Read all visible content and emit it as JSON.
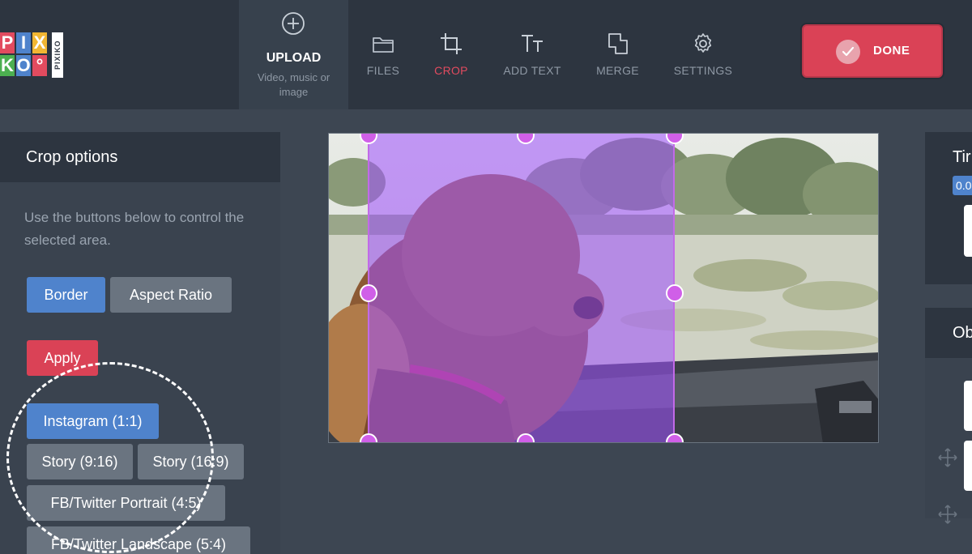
{
  "logo": {
    "row1": [
      "P",
      "I",
      "X",
      "I"
    ],
    "row2": [
      "K",
      "O",
      "°"
    ],
    "vertical_text": "PIXIKO",
    "tile_colors": [
      "#e24b5f",
      "#4f83cc",
      "#f2b632",
      "#4caf50"
    ]
  },
  "toolbar": {
    "upload": {
      "title": "UPLOAD",
      "subtitle": "Video, music or image",
      "icon": "plus-circle-icon"
    },
    "tools": [
      {
        "label": "FILES",
        "icon": "folder-icon",
        "active": false
      },
      {
        "label": "CROP",
        "icon": "crop-icon",
        "active": true
      },
      {
        "label": "ADD TEXT",
        "icon": "text-icon",
        "active": false
      },
      {
        "label": "MERGE",
        "icon": "merge-icon",
        "active": false
      },
      {
        "label": "SETTINGS",
        "icon": "gear-icon",
        "active": false
      }
    ],
    "done_label": "DONE"
  },
  "crop_panel": {
    "title": "Crop options",
    "description": "Use the buttons below to control the selected area.",
    "mode_buttons": [
      {
        "label": "Border",
        "selected": true
      },
      {
        "label": "Aspect Ratio",
        "selected": false
      }
    ],
    "apply_label": "Apply",
    "presets": [
      {
        "label": "Instagram (1:1)",
        "selected": true
      },
      {
        "label": "Story (9:16)",
        "selected": false
      },
      {
        "label": "Story (16:9)",
        "selected": false
      },
      {
        "label": "FB/Twitter Portrait (4:5)",
        "selected": false
      },
      {
        "label": "FB/Twitter Landscape (5:4)",
        "selected": false
      }
    ]
  },
  "right_panel": {
    "timeline_title": "Tir",
    "timeline_value": "0.0",
    "objects_title": "Ob"
  },
  "colors": {
    "accent_red": "#da4256",
    "accent_blue": "#4f83cc",
    "crop_overlay": "#a050ff"
  }
}
